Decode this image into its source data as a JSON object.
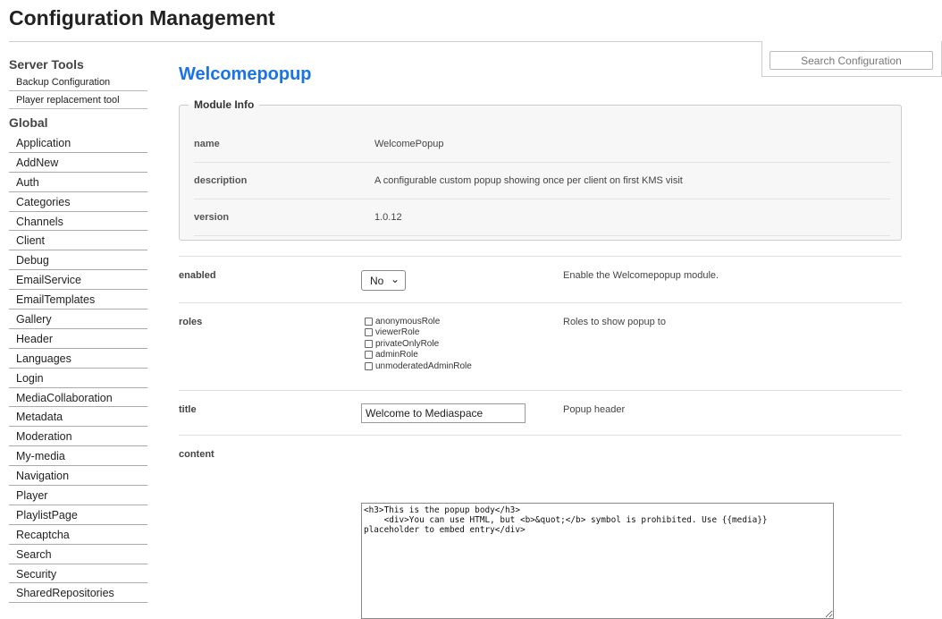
{
  "page": {
    "title": "Configuration Management"
  },
  "search": {
    "placeholder": "Search Configuration"
  },
  "sidebar": {
    "server_tools": {
      "header": "Server Tools",
      "items": [
        "Backup Configuration",
        "Player replacement tool"
      ]
    },
    "global": {
      "header": "Global",
      "items": [
        "Application",
        "AddNew",
        "Auth",
        "Categories",
        "Channels",
        "Client",
        "Debug",
        "EmailService",
        "EmailTemplates",
        "Gallery",
        "Header",
        "Languages",
        "Login",
        "MediaCollaboration",
        "Metadata",
        "Moderation",
        "My-media",
        "Navigation",
        "Player",
        "PlaylistPage",
        "Recaptcha",
        "Search",
        "Security",
        "SharedRepositories"
      ]
    }
  },
  "module": {
    "title": "Welcomepopup",
    "info_legend": "Module Info",
    "info": [
      {
        "key": "name",
        "value": "WelcomePopup"
      },
      {
        "key": "description",
        "value": "A configurable custom popup showing once per client on first KMS visit"
      },
      {
        "key": "version",
        "value": "1.0.12"
      }
    ]
  },
  "fields": {
    "enabled": {
      "label": "enabled",
      "value": "No",
      "description": "Enable the Welcomepopup module."
    },
    "roles": {
      "label": "roles",
      "description": "Roles to show popup to",
      "options": [
        "anonymousRole",
        "viewerRole",
        "privateOnlyRole",
        "adminRole",
        "unmoderatedAdminRole"
      ]
    },
    "title": {
      "label": "title",
      "value": "Welcome to Mediaspace",
      "description": "Popup header"
    },
    "content": {
      "label": "content",
      "value": "<h3>This is the popup body</h3>\n    <div>You can use HTML, but <b>&quot;</b> symbol is prohibited. Use {{media}}\nplaceholder to embed entry</div>"
    }
  }
}
